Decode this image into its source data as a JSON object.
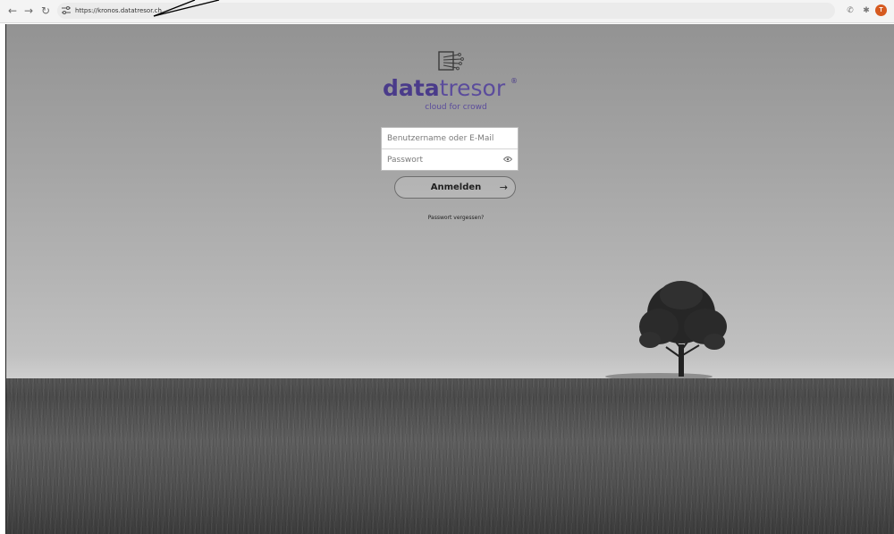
{
  "browser": {
    "url": "https://kronos.datatresor.ch",
    "icons": {
      "back": "back-arrow-icon",
      "forward": "forward-arrow-icon",
      "reload": "reload-icon",
      "site": "site-settings-icon",
      "phone": "phone-icon",
      "extensions": "extensions-puzzle-icon",
      "profile": "profile-avatar"
    },
    "profile_initial": "T",
    "profile_color": "#d65a20"
  },
  "login": {
    "brand_bold": "data",
    "brand_light": "tresor",
    "brand_mark": "®",
    "tagline": "cloud for crowd",
    "username_placeholder": "Benutzername oder E-Mail",
    "password_placeholder": "Passwort",
    "submit_label": "Anmelden",
    "forgot_label": "Passwort vergessen?",
    "brand_color": "#4a3b8a"
  }
}
